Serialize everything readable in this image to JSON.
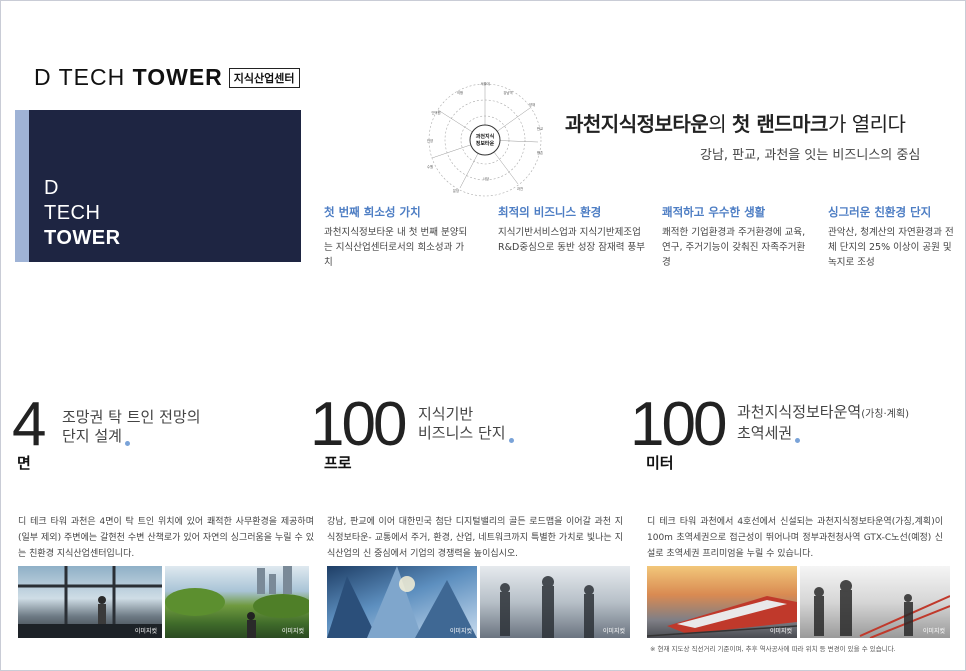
{
  "logo": {
    "main_light": "D TECH",
    "main_bold": "TOWER",
    "sub": "지식산업센터"
  },
  "brand": {
    "line1": "D",
    "line2": "TECH",
    "line3": "TOWER"
  },
  "diagram": {
    "center_line1": "과천지식",
    "center_line2": "정보타운",
    "nodes": [
      "서울대",
      "강남역",
      "양재",
      "판교",
      "평촌",
      "과천",
      "사당",
      "분당",
      "수원",
      "안양",
      "인덕원",
      "의왕"
    ]
  },
  "headline": {
    "part1": "과천지식정보타운",
    "part2": "의 ",
    "part3": "첫 랜드마크",
    "part4": "가  열리다"
  },
  "subhead": "강남, 판교, 과천을 잇는 비즈니스의 중심",
  "features": [
    {
      "title": "첫 번째 희소성 가치",
      "desc": "과천지식정보타운 내 첫 번째 분양되는 지식산업센터로서의 희소성과 가치"
    },
    {
      "title": "최적의 비즈니스 환경",
      "desc": "지식기반서비스업과 지식기반제조업 R&D중심으로 동반 성장 잠재력 풍부"
    },
    {
      "title": "쾌적하고 우수한 생활",
      "desc": "쾌적한 기업환경과 주거환경에 교육, 연구, 주거기능이 갖춰진 자족주거환경"
    },
    {
      "title": "싱그러운 친환경 단지",
      "desc": "관악산, 청계산의 자연환경과 전체 단지의 25% 이상이 공원 및 녹지로 조성"
    }
  ],
  "stats": [
    {
      "num": "4",
      "unit": "면",
      "desc1": "조망권 탁 트인 전망의",
      "desc2": "단지 설계",
      "desc_small": ""
    },
    {
      "num": "100",
      "unit": "프로",
      "desc1": "지식기반",
      "desc2": "비즈니스 단지",
      "desc_small": ""
    },
    {
      "num": "100",
      "unit": "미터",
      "desc1": "과천지식정보타운역",
      "desc2": "초역세권",
      "desc_small": "(가칭·계획)"
    }
  ],
  "body": [
    "디 테크 타워 과천은 4면이 탁 트인 위치에 있어 쾌적한 사무환경을 제공하며 (일부 제외) 주변에는 갈현천 수변 산책로가 있어 자연의 싱그러움을 누릴 수 있는 친환경 지식산업센터입니다.",
    "강남, 판교에 이어 대한민국 첨단 디지털밸리의 골든 로드맵을 이어갈 과천 지식정보타운- 교통에서 주거, 환경, 산업, 네트워크까지 특별한 가치로 빛나는 지식산업의 신 중심에서 기업의 경쟁력을 높이십시오.",
    "디 테크 타워 과천에서 4호선에서 신설되는 과천지식정보타운역(가칭,계획)이 100m 초역세권으로 접근성이 뛰어나며 정부과천청사역 GTX-C노선(예정) 신설로 초역세권 프리미엄을 누릴 수 있습니다."
  ],
  "photos": [
    {
      "caption": "이미지컷"
    },
    {
      "caption": "이미지컷"
    },
    {
      "caption": "이미지컷"
    },
    {
      "caption": "이미지컷"
    },
    {
      "caption": "이미지컷"
    },
    {
      "caption": "이미지컷"
    }
  ],
  "footnote": "※ 현재 지도상 직선거리 기준이며, 추후 역사공사에 따라 위치 등 변경이 있을 수 있습니다.",
  "colors": {
    "navy": "#1e2542",
    "accent_blue": "#4e7ec4",
    "stripe": "#9fb3d6"
  }
}
